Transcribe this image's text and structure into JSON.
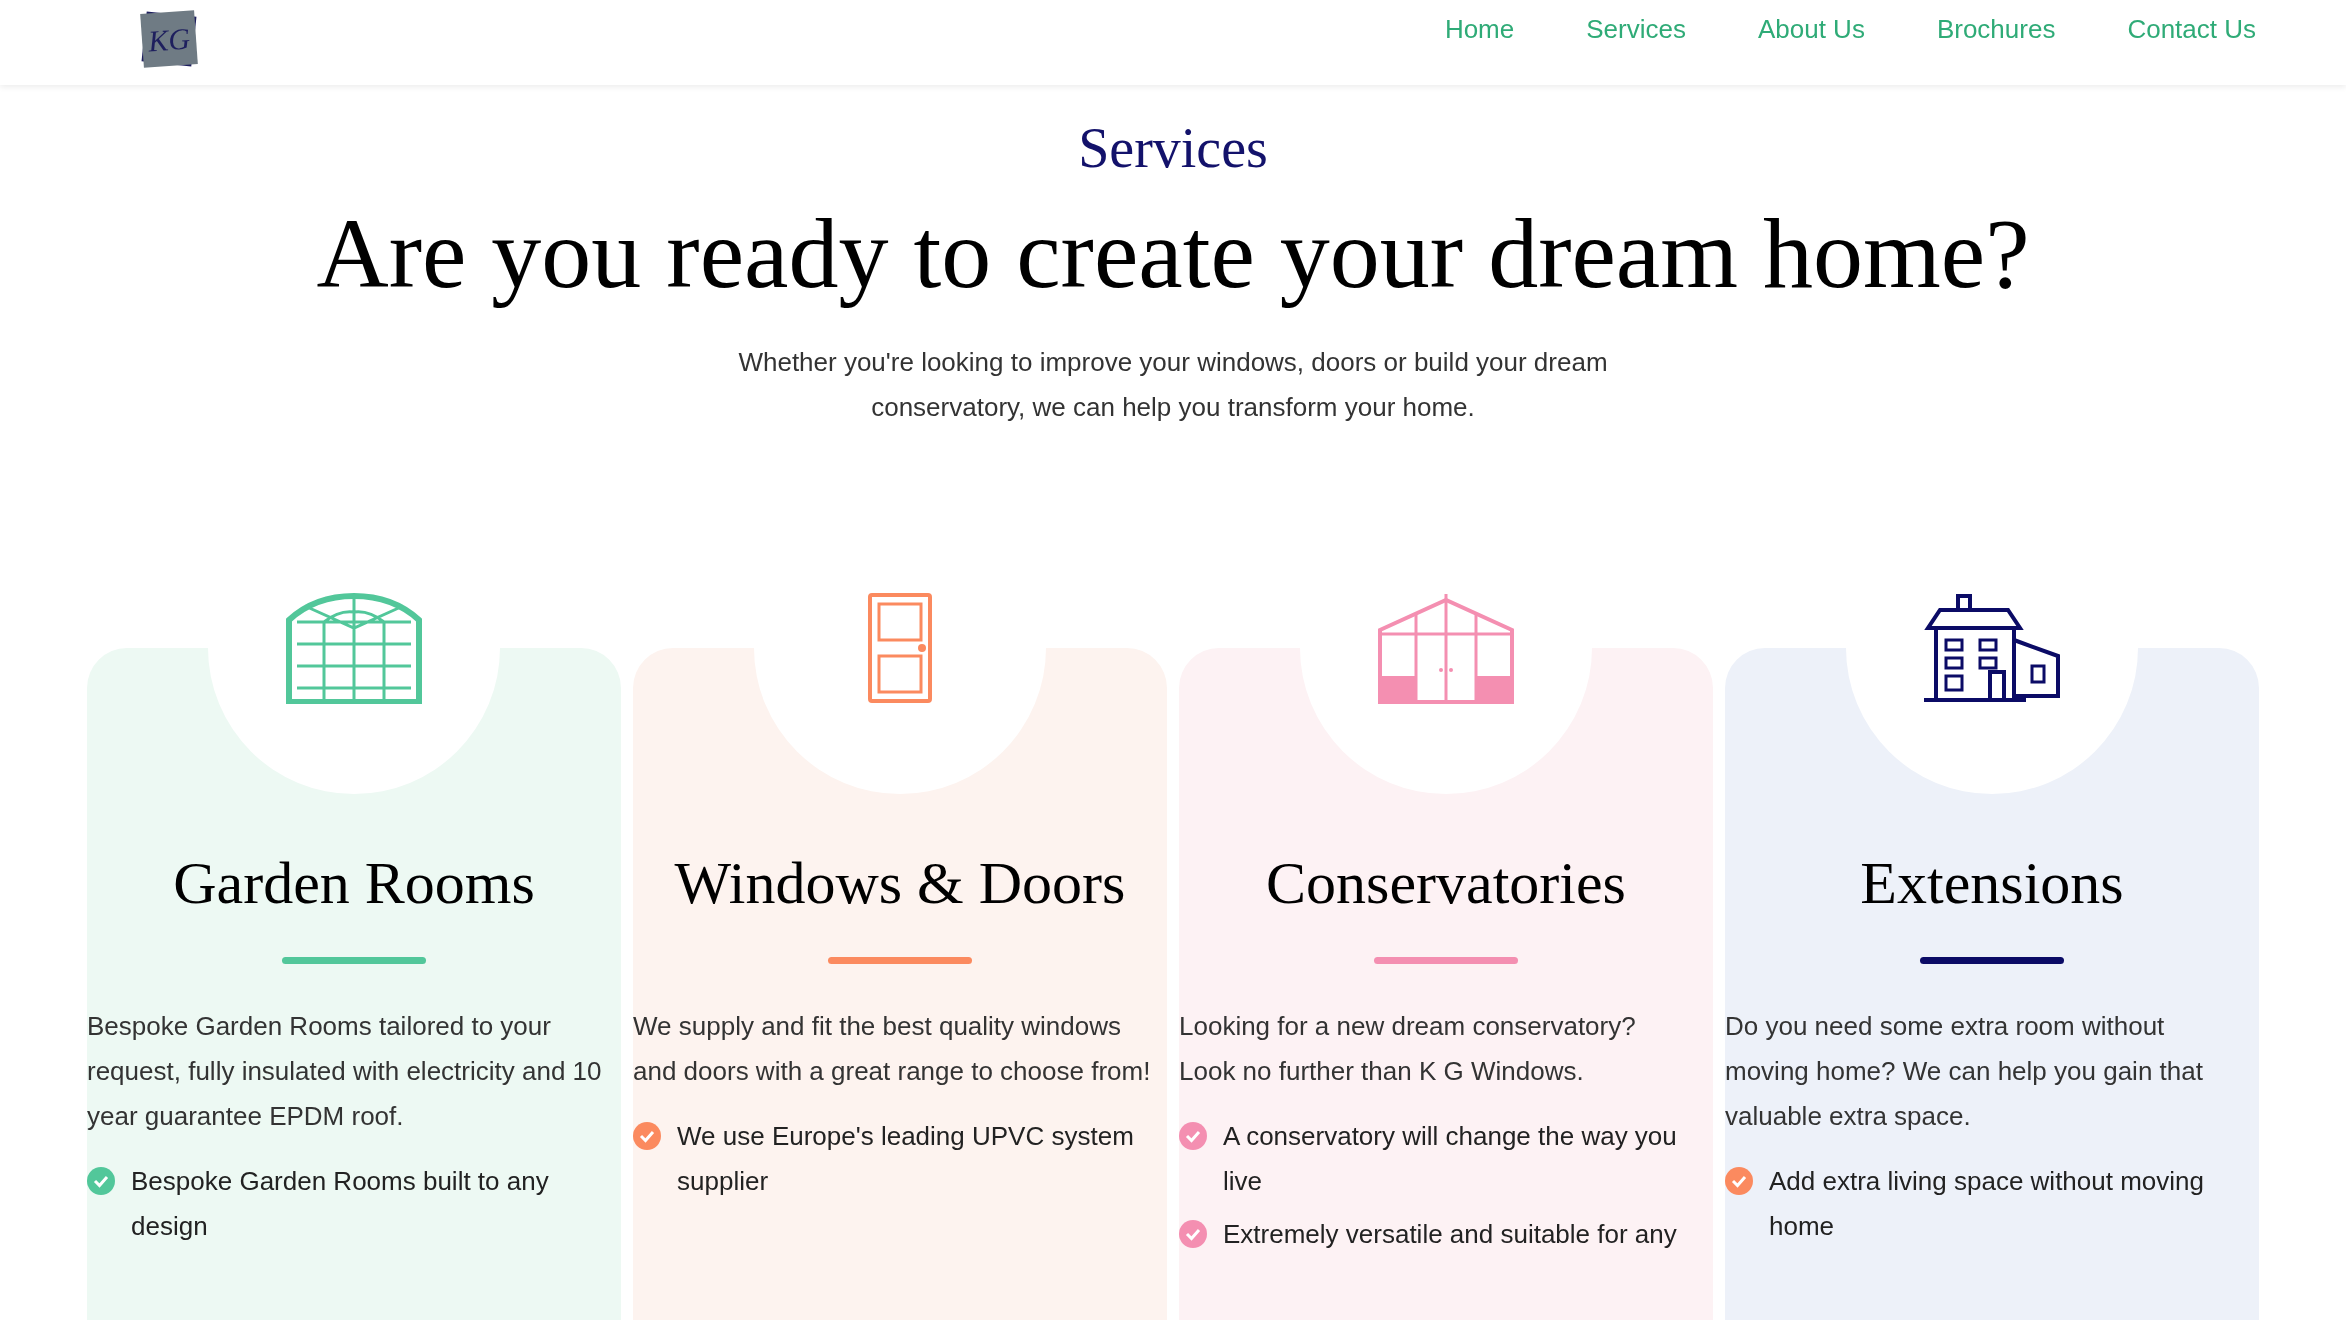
{
  "logo": {
    "text": "KG"
  },
  "nav": [
    {
      "label": "Home"
    },
    {
      "label": "Services"
    },
    {
      "label": "About Us"
    },
    {
      "label": "Brochures"
    },
    {
      "label": "Contact Us"
    }
  ],
  "hero": {
    "eyebrow": "Services",
    "title": "Are you ready to create your dream home?",
    "text": "Whether you're looking to improve your windows, doors or build your dream conservatory, we can help you transform your home."
  },
  "cards": [
    {
      "kind": "arch-window",
      "color": "#52c79a",
      "title": "Garden Rooms",
      "text": "Bespoke Garden Rooms tailored to your request, fully insulated with electricity and 10 year guarantee EPDM roof.",
      "bullets": [
        {
          "text": "Bespoke Garden Rooms built to any design",
          "kind": "green"
        }
      ]
    },
    {
      "kind": "door",
      "color": "#fb8a5f",
      "title": "Windows & Doors",
      "text": "We supply and fit the best quality windows and doors with a great range to choose from!",
      "bullets": [
        {
          "text": "We use Europe's leading UPVC system supplier",
          "kind": "orange"
        }
      ]
    },
    {
      "kind": "conservatory",
      "color": "#f48fb1",
      "title": "Conservatories",
      "text": "Looking for a new dream conservatory? Look no further than K G Windows.",
      "bullets": [
        {
          "text": "A conservatory will change the way you live",
          "kind": "pink"
        },
        {
          "text": "Extremely versatile and suitable for any",
          "kind": "pink"
        }
      ]
    },
    {
      "kind": "house",
      "color": "#0b0b66",
      "title": "Extensions",
      "text": "Do you need some extra room without moving home? We can help you gain that valuable extra space.",
      "bullets": [
        {
          "text": "Add extra living space without moving home",
          "kind": "orange"
        }
      ]
    }
  ]
}
